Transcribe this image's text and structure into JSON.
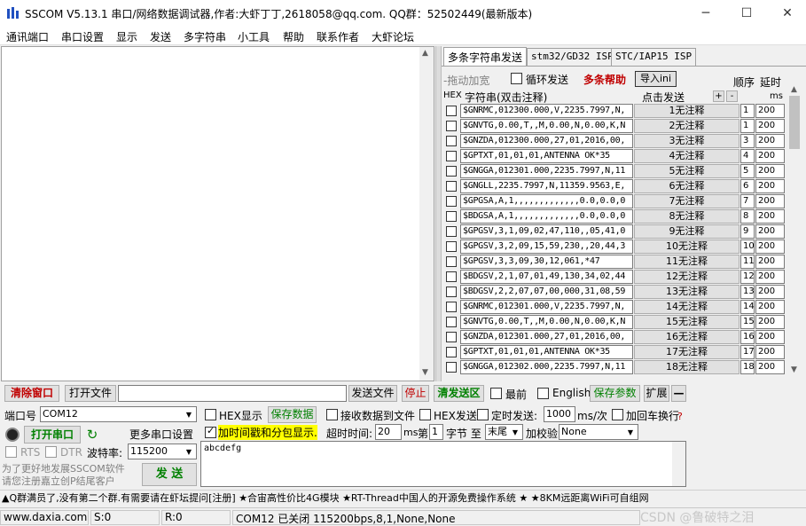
{
  "window": {
    "title": "SSCOM V5.13.1 串口/网络数据调试器,作者:大虾丁丁,2618058@qq.com. QQ群：52502449(最新版本)",
    "min_icon": "minimize-icon",
    "max_icon": "maximize-icon",
    "close_icon": "close-icon"
  },
  "menu": [
    "通讯端口",
    "串口设置",
    "显示",
    "发送",
    "多字符串",
    "小工具",
    "帮助",
    "联系作者",
    "大虾论坛"
  ],
  "tabs": [
    "多条字符串发送",
    "stm32/GD32 ISP",
    "STC/IAP15 ISP"
  ],
  "multi": {
    "drag_label": "-拖动加宽",
    "loop_label": "循环发送",
    "help_label": "多条帮助",
    "import_label": "导入ini",
    "order_header": "顺序",
    "delay_header": "延时",
    "hex_header": "HEX",
    "string_header": "字符串(双击注释)",
    "click_send_header": "点击发送",
    "plus": "+",
    "minus": "-",
    "ms_header": "ms",
    "rows": [
      {
        "cmd": "$GNRMC,012300.000,V,2235.7997,N,",
        "send": "1无注释",
        "order": "1",
        "delay": "200"
      },
      {
        "cmd": "$GNVTG,0.00,T,,M,0.00,N,0.00,K,N",
        "send": "2无注释",
        "order": "1",
        "delay": "200"
      },
      {
        "cmd": "$GNZDA,012300.000,27,01,2016,00,",
        "send": "3无注释",
        "order": "3",
        "delay": "200"
      },
      {
        "cmd": "$GPTXT,01,01,01,ANTENNA OK*35",
        "send": "4无注释",
        "order": "4",
        "delay": "200"
      },
      {
        "cmd": "$GNGGA,012301.000,2235.7997,N,11",
        "send": "5无注释",
        "order": "5",
        "delay": "200"
      },
      {
        "cmd": "$GNGLL,2235.7997,N,11359.9563,E,",
        "send": "6无注释",
        "order": "6",
        "delay": "200"
      },
      {
        "cmd": "$GPGSA,A,1,,,,,,,,,,,,,0.0,0.0,0",
        "send": "7无注释",
        "order": "7",
        "delay": "200"
      },
      {
        "cmd": "$BDGSA,A,1,,,,,,,,,,,,,0.0,0.0,0",
        "send": "8无注释",
        "order": "8",
        "delay": "200"
      },
      {
        "cmd": "$GPGSV,3,1,09,02,47,110,,05,41,0",
        "send": "9无注释",
        "order": "9",
        "delay": "200"
      },
      {
        "cmd": "$GPGSV,3,2,09,15,59,230,,20,44,3",
        "send": "10无注释",
        "order": "10",
        "delay": "200"
      },
      {
        "cmd": "$GPGSV,3,3,09,30,12,061,*47",
        "send": "11无注释",
        "order": "11",
        "delay": "200"
      },
      {
        "cmd": "$BDGSV,2,1,07,01,49,130,34,02,44",
        "send": "12无注释",
        "order": "12",
        "delay": "200"
      },
      {
        "cmd": "$BDGSV,2,2,07,07,00,000,31,08,59",
        "send": "13无注释",
        "order": "13",
        "delay": "200"
      },
      {
        "cmd": "$GNRMC,012301.000,V,2235.7997,N,",
        "send": "14无注释",
        "order": "14",
        "delay": "200"
      },
      {
        "cmd": "$GNVTG,0.00,T,,M,0.00,N,0.00,K,N",
        "send": "15无注释",
        "order": "15",
        "delay": "200"
      },
      {
        "cmd": "$GNZDA,012301.000,27,01,2016,00,",
        "send": "16无注释",
        "order": "16",
        "delay": "200"
      },
      {
        "cmd": "$GPTXT,01,01,01,ANTENNA OK*35",
        "send": "17无注释",
        "order": "17",
        "delay": "200"
      },
      {
        "cmd": "$GNGGA,012302.000,2235.7997,N,11",
        "send": "18无注释",
        "order": "18",
        "delay": "200"
      }
    ]
  },
  "toolbar": {
    "clear_label": "清除窗口",
    "open_file_label": "打开文件",
    "file_path": "",
    "send_file_label": "发送文件",
    "stop_label": "停止",
    "clear_send_label": "清发送区",
    "last_label": "最前",
    "english_label": "English",
    "save_params_label": "保存参数",
    "expand_label": "扩展",
    "dash": "—"
  },
  "port": {
    "port_label": "端口号",
    "port_value": "COM12",
    "open_label": "打开串口",
    "more_settings_label": "更多串口设置",
    "rts_label": "RTS",
    "dtr_label": "DTR",
    "baud_label": "波特率:",
    "baud_value": "115200",
    "promo_text": "为了更好地发展SSCOM软件\n请您注册嘉立创P结尾客户",
    "send_label": "发 送"
  },
  "options": {
    "hex_display": "HEX显示",
    "save_data": "保存数据",
    "recv_to_file": "接收数据到文件",
    "hex_send": "HEX发送",
    "timed_send": "定时发送:",
    "timed_value": "1000",
    "ms_per": "ms/次",
    "add_crlf": "加回车换行",
    "timestamp": "加时间戳和分包显示.",
    "timeout_label": "超时时间:",
    "timeout_value": "20",
    "ms": "ms",
    "byte_prefix": "第",
    "byte_value": "1",
    "byte_to": "字节 至",
    "end_value": "末尾",
    "checksum_label": "加校验",
    "checksum_value": "None"
  },
  "send_text": "abcdefg",
  "ad_text": "▲Q群满员了,没有第二个群.有需要请在虾坛提问[注册] ★合宙高性价比4G模块 ★RT-Thread中国人的开源免费操作系统 ★ ★8KM远距离WiFi可自组网",
  "status": {
    "website": "www.daxia.com",
    "sent": "S:0",
    "received": "R:0",
    "port_state": "COM12 已关闭  115200bps,8,1,None,None"
  },
  "watermark": "CSDN @鲁破特之泪"
}
